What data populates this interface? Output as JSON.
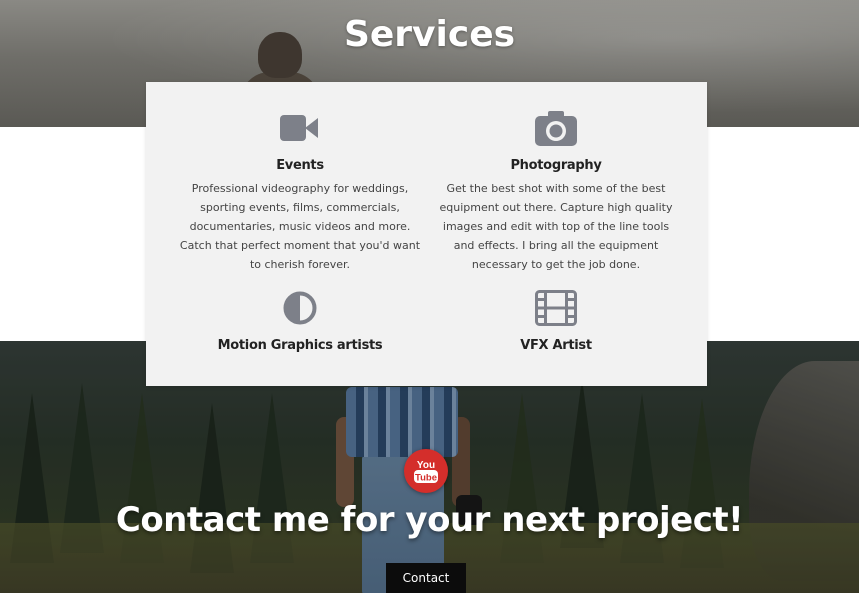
{
  "services": {
    "title": "Services",
    "items": [
      {
        "title": "Events",
        "icon": "video-camera-icon",
        "description": "Professional videography for weddings, sporting events, films, commercials, documentaries, music videos and more. Catch that perfect moment that you'd want to cherish forever."
      },
      {
        "title": "Photography",
        "icon": "camera-icon",
        "description": "Get the best shot with some of the best equipment out there. Capture high quality images and edit with top of the line tools and effects. I bring all the equipment necessary to get the job done."
      },
      {
        "title": "Motion Graphics artists",
        "icon": "half-circle-icon",
        "description": ""
      },
      {
        "title": "VFX Artist",
        "icon": "film-strip-icon",
        "description": ""
      }
    ]
  },
  "contact": {
    "badge_icon": "youtube-icon",
    "badge_text_top": "You",
    "badge_text_bottom": "Tube",
    "heading": "Contact me for your next project!",
    "button_label": "Contact"
  },
  "colors": {
    "icon_gray": "#7d8089",
    "card_bg": "#f2f2f2",
    "youtube_red": "#d42e2b",
    "button_bg": "#0c0c0c"
  }
}
